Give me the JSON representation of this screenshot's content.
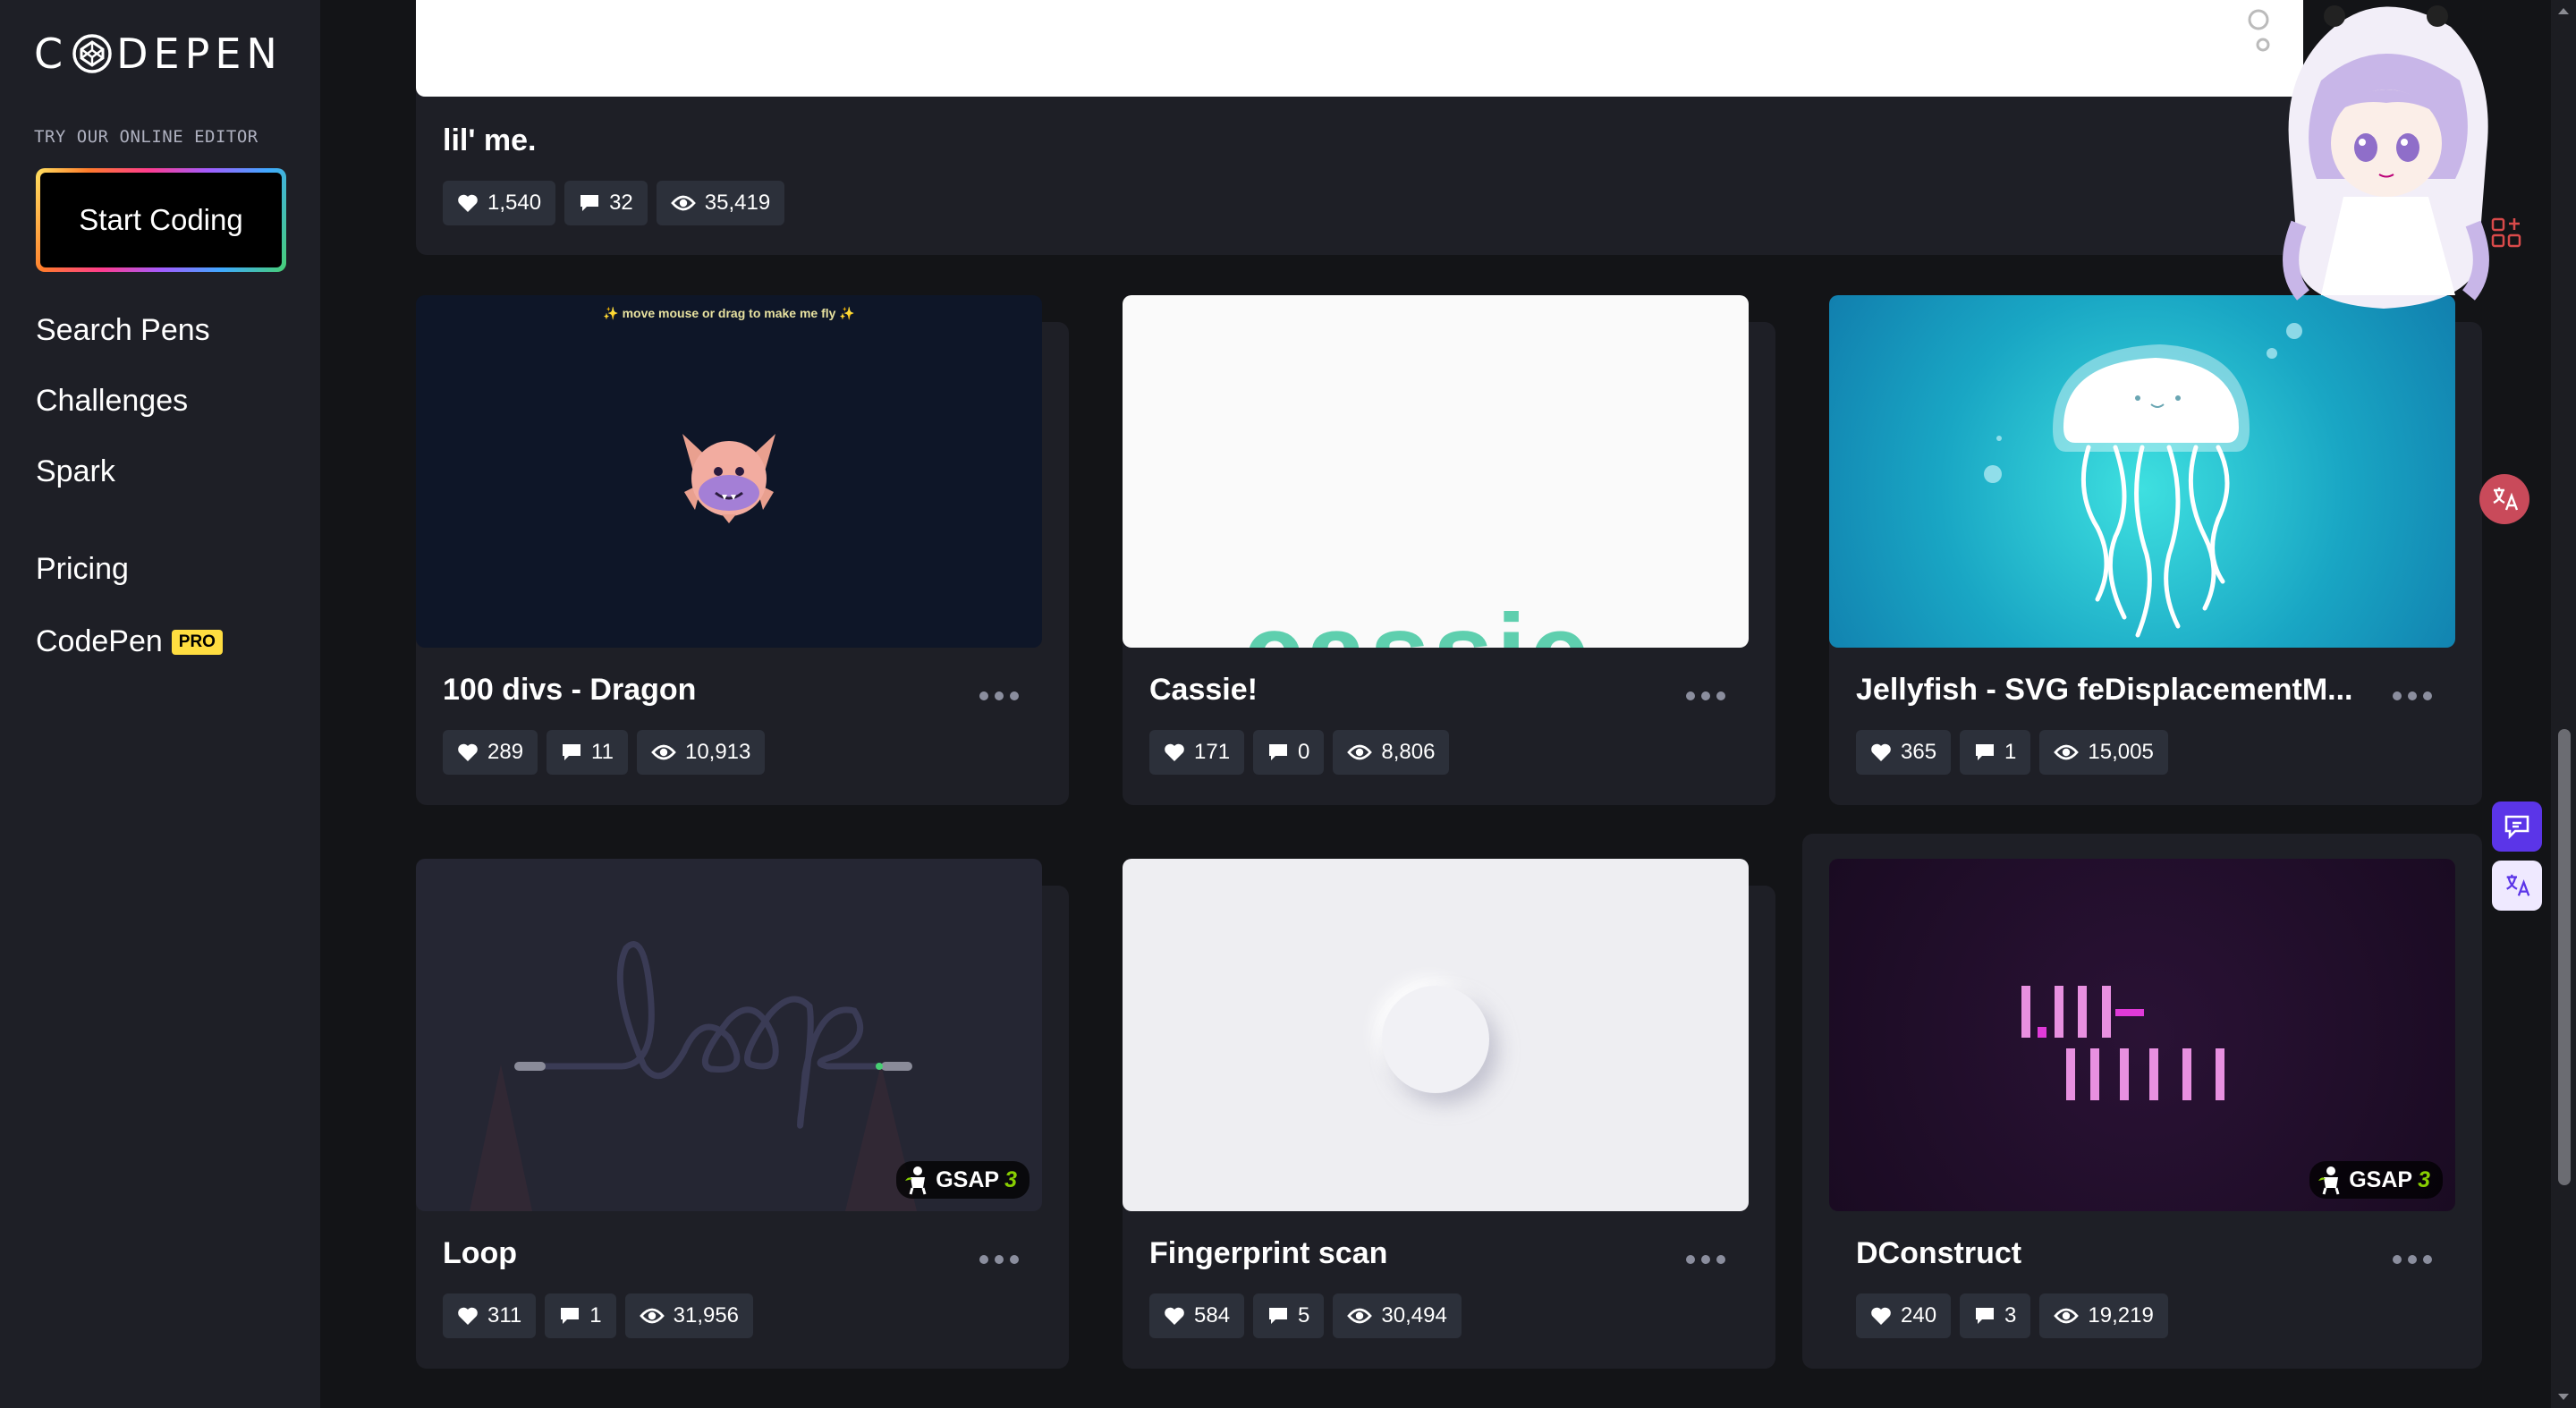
{
  "sidebar": {
    "logo_text": "CODEPEN",
    "try_label": "TRY OUR ONLINE EDITOR",
    "start_button": "Start Coding",
    "nav": [
      "Search Pens",
      "Challenges",
      "Spark",
      "Pricing",
      "CodePen"
    ],
    "pro_badge": "PRO"
  },
  "top_card": {
    "title": "lil' me.",
    "likes": "1,540",
    "comments": "32",
    "views": "35,419"
  },
  "cards": [
    {
      "title": "100 divs - Dragon",
      "likes": "289",
      "comments": "11",
      "views": "10,913",
      "preview_text": "✨ move mouse or drag to make me fly ✨"
    },
    {
      "title": "Cassie!",
      "likes": "171",
      "comments": "0",
      "views": "8,806",
      "preview_text": "cassie"
    },
    {
      "title": "Jellyfish - SVG feDisplacementM...",
      "likes": "365",
      "comments": "1",
      "views": "15,005"
    },
    {
      "title": "Loop",
      "likes": "311",
      "comments": "1",
      "views": "31,956",
      "badge": "GSAP",
      "badge_num": "3"
    },
    {
      "title": "Fingerprint scan",
      "likes": "584",
      "comments": "5",
      "views": "30,494"
    },
    {
      "title": "DConstruct",
      "likes": "240",
      "comments": "3",
      "views": "19,219",
      "badge": "GSAP",
      "badge_num": "3"
    }
  ],
  "colors": {
    "background": "#131417",
    "card": "#1e1f26",
    "stat_bg": "#2c303a",
    "pro_yellow": "#ffdd40",
    "gsap_green": "#88ce02"
  }
}
